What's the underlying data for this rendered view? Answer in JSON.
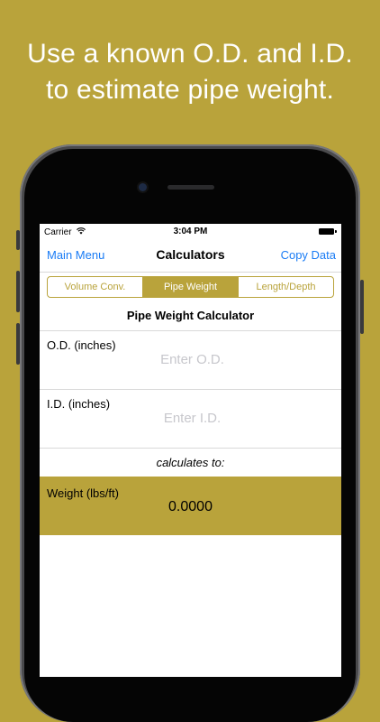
{
  "headline": {
    "line1": "Use a known O.D. and I.D.",
    "line2": "to estimate pipe weight."
  },
  "status_bar": {
    "carrier": "Carrier",
    "time": "3:04 PM"
  },
  "navbar": {
    "left": "Main Menu",
    "title": "Calculators",
    "right": "Copy Data"
  },
  "segments": [
    {
      "label": "Volume Conv.",
      "active": false
    },
    {
      "label": "Pipe Weight",
      "active": true
    },
    {
      "label": "Length/Depth",
      "active": false
    }
  ],
  "calculator": {
    "title": "Pipe Weight Calculator",
    "od_label": "O.D. (inches)",
    "od_placeholder": "Enter O.D.",
    "id_label": "I.D. (inches)",
    "id_placeholder": "Enter I.D.",
    "calculates_to": "calculates to:",
    "result_label": "Weight (lbs/ft)",
    "result_value": "0.0000"
  },
  "colors": {
    "brand": "#b9a33b",
    "link": "#1a7cf5"
  }
}
